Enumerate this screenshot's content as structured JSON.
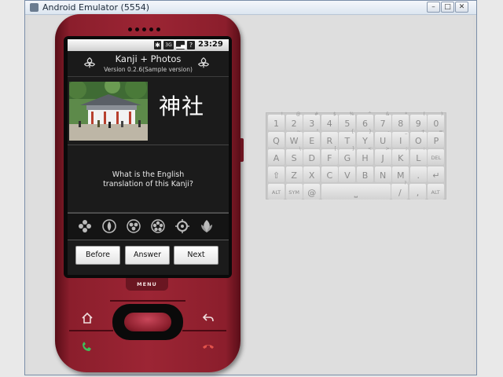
{
  "window": {
    "title": "Android Emulator (5554)",
    "controls": {
      "minimize": "–",
      "maximize": "□",
      "close": "✕"
    }
  },
  "phone": {
    "status_bar": {
      "time": "23:29",
      "icons": [
        "bluetooth-icon",
        "3g-signal-icon",
        "signal-bars-icon",
        "help-icon",
        "battery-icon"
      ]
    },
    "app": {
      "title": "Kanji + Photos",
      "version": "Version 0.2.6(Sample version)",
      "kanji": "神社",
      "question_line1": "What is the English",
      "question_line2": "translation of this Kanji?",
      "buttons": {
        "before": "Before",
        "answer": "Answer",
        "next": "Next"
      }
    },
    "menu_label": "MENU"
  },
  "keyboard": {
    "rows": [
      [
        {
          "k": "1",
          "s": "!"
        },
        {
          "k": "2",
          "s": "@"
        },
        {
          "k": "3",
          "s": "#"
        },
        {
          "k": "4",
          "s": "$"
        },
        {
          "k": "5",
          "s": "%"
        },
        {
          "k": "6",
          "s": "^"
        },
        {
          "k": "7",
          "s": "&"
        },
        {
          "k": "8",
          "s": "*"
        },
        {
          "k": "9",
          "s": "("
        },
        {
          "k": "0",
          "s": ")"
        }
      ],
      [
        {
          "k": "Q",
          "s": ""
        },
        {
          "k": "W",
          "s": "~"
        },
        {
          "k": "E",
          "s": "\""
        },
        {
          "k": "R",
          "s": ""
        },
        {
          "k": "T",
          "s": "{"
        },
        {
          "k": "Y",
          "s": "}"
        },
        {
          "k": "U",
          "s": "-"
        },
        {
          "k": "I",
          "s": "_"
        },
        {
          "k": "O",
          "s": "+"
        },
        {
          "k": "P",
          "s": "="
        }
      ],
      [
        {
          "k": "A",
          "s": ""
        },
        {
          "k": "S",
          "s": "\\"
        },
        {
          "k": "D",
          "s": ""
        },
        {
          "k": "F",
          "s": "["
        },
        {
          "k": "G",
          "s": "]"
        },
        {
          "k": "H",
          "s": "<"
        },
        {
          "k": "J",
          "s": ">"
        },
        {
          "k": "K",
          "s": ";"
        },
        {
          "k": "L",
          "s": ":"
        },
        {
          "k": "DEL",
          "s": ""
        }
      ],
      [
        {
          "k": "⇧",
          "s": ""
        },
        {
          "k": "Z",
          "s": ""
        },
        {
          "k": "X",
          "s": ""
        },
        {
          "k": "C",
          "s": ""
        },
        {
          "k": "V",
          "s": ""
        },
        {
          "k": "B",
          "s": ""
        },
        {
          "k": "N",
          "s": ""
        },
        {
          "k": "M",
          "s": ""
        },
        {
          "k": ".",
          "s": ""
        },
        {
          "k": "↵",
          "s": ""
        }
      ],
      [
        {
          "k": "ALT",
          "s": ""
        },
        {
          "k": "SYM",
          "s": ""
        },
        {
          "k": "@",
          "s": ""
        },
        {
          "k": "⎵",
          "s": ""
        },
        {
          "k": "/",
          "s": "?"
        },
        {
          "k": ",",
          "s": ""
        },
        {
          "k": "ALT",
          "s": ""
        }
      ]
    ]
  },
  "colors": {
    "phone_body": "#9c2534",
    "screen_bg": "#1b1b1b",
    "keyboard_bg": "#c9c9c9"
  }
}
